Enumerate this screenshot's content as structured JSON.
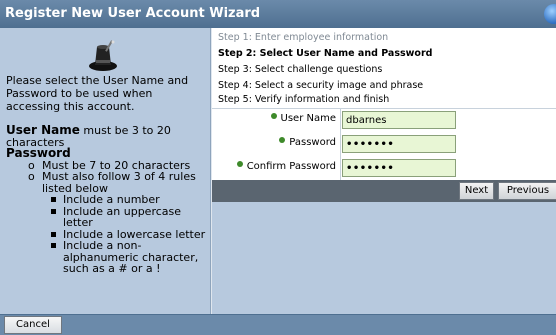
{
  "window": {
    "title": "Register New User Account Wizard"
  },
  "sidebar": {
    "intro": "Please select the User Name and Password to be used when accessing this account.",
    "rules": {
      "username_heading": "User Name",
      "username_text": " must be 3 to 20 characters",
      "password_heading": "Password",
      "password_rules": [
        "Must be 7 to 20 characters",
        "Must also follow 3 of 4 rules listed below"
      ],
      "sub_rules": [
        "Include a number",
        "Include an uppercase letter",
        "Include a lowercase letter",
        "Include a non-alphanumeric character, such as a # or a !"
      ]
    }
  },
  "steps": [
    {
      "label": "Step 1: Enter employee information",
      "state": "done"
    },
    {
      "label": "Step 2: Select User Name and Password",
      "state": "current"
    },
    {
      "label": "Step 3: Select challenge questions",
      "state": "pending"
    },
    {
      "label": "Step 4: Select a security image and phrase",
      "state": "pending"
    },
    {
      "label": "Step 5: Verify information and finish",
      "state": "pending"
    }
  ],
  "form": {
    "username": {
      "label": "User Name",
      "value": "dbarnes"
    },
    "password": {
      "label": "Password",
      "value": "•••••••"
    },
    "confirm_password": {
      "label": "Confirm Password",
      "value": "•••••••"
    }
  },
  "buttons": {
    "next": "Next",
    "previous": "Previous",
    "cancel": "Cancel"
  },
  "colors": {
    "titlebar": "#5b7a9a",
    "sidebar": "#b7c9de",
    "field_bg": "#e8f6d5",
    "required_dot": "#3e8a2a"
  },
  "icons": {
    "wizard": "top-hat-icon",
    "required": "required-dot-icon"
  }
}
